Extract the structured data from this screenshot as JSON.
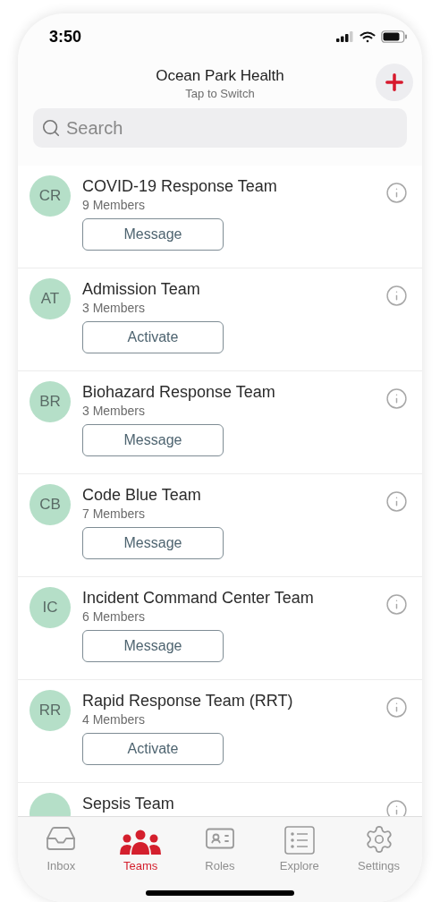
{
  "status_bar": {
    "time": "3:50"
  },
  "header": {
    "title": "Ocean Park Health",
    "subtitle": "Tap to Switch"
  },
  "search": {
    "placeholder": "Search"
  },
  "teams": [
    {
      "initials": "CR",
      "name": "COVID-19 Response Team",
      "members": "9 Members",
      "action": "Message"
    },
    {
      "initials": "AT",
      "name": "Admission Team",
      "members": "3 Members",
      "action": "Activate"
    },
    {
      "initials": "BR",
      "name": "Biohazard Response Team",
      "members": "3 Members",
      "action": "Message"
    },
    {
      "initials": "CB",
      "name": "Code Blue Team",
      "members": "7 Members",
      "action": "Message"
    },
    {
      "initials": "IC",
      "name": "Incident Command Center Team",
      "members": "6 Members",
      "action": "Message"
    },
    {
      "initials": "RR",
      "name": "Rapid Response Team (RRT)",
      "members": "4 Members",
      "action": "Activate"
    },
    {
      "name": "Sepsis Team"
    }
  ],
  "tab_bar": [
    {
      "kind": "inbox",
      "label": "Inbox",
      "selected": false
    },
    {
      "kind": "teams",
      "label": "Teams",
      "selected": true
    },
    {
      "kind": "roles",
      "label": "Roles",
      "selected": false
    },
    {
      "kind": "explore",
      "label": "Explore",
      "selected": false
    },
    {
      "kind": "settings",
      "label": "Settings",
      "selected": false
    }
  ]
}
